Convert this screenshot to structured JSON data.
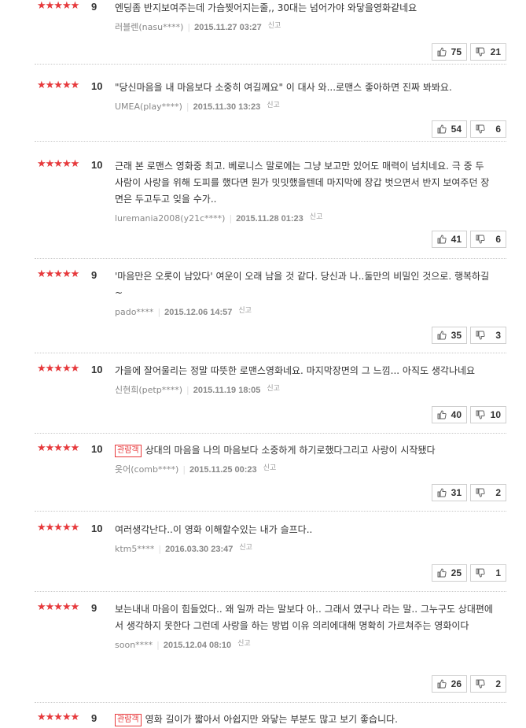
{
  "labels": {
    "report": "신고",
    "badge_watched": "관람객"
  },
  "colors": {
    "star": "#e8393c",
    "badge": "#e8393c"
  },
  "reviews": [
    {
      "score": "9",
      "rating": 9,
      "watched": false,
      "text": "엔딩좀 반지보여주는데 가슴찢어지는줄,, 30대는 넘어가야 와닿을영화같네요",
      "user": "러블렌(nasu****)",
      "date": "2015.11.27 03:27",
      "up": "75",
      "down": "21"
    },
    {
      "score": "10",
      "rating": 10,
      "watched": false,
      "text": "\"당신마음을 내 마음보다 소중히 여길께요\" 이 대사 와...로맨스 좋아하면 진짜 봐봐요.",
      "user": "UMEA(play****)",
      "date": "2015.11.30 13:23",
      "up": "54",
      "down": "6"
    },
    {
      "score": "10",
      "rating": 10,
      "watched": false,
      "text": "근래 본 로맨스 영화중 최고. 베로니스 말로에는 그냥 보고만 있어도 매력이 넘치네요. 극 중 두 사람이 사랑을 위해 도피를 했다면 뭔가 밋밋했을텐데 마지막에 장갑 벗으면서 반지 보여주던 장면은 두고두고 잊을 수가..",
      "user": "luremania2008(y21c****)",
      "date": "2015.11.28 01:23",
      "up": "41",
      "down": "6"
    },
    {
      "score": "9",
      "rating": 9,
      "watched": false,
      "text": "'마음만은 오롯이 남았다' 여운이 오래 남을 것 같다. 당신과 나..둘만의 비밀인 것으로. 행복하길~",
      "user": "pado****",
      "date": "2015.12.06 14:57",
      "up": "35",
      "down": "3"
    },
    {
      "score": "10",
      "rating": 10,
      "watched": false,
      "text": "가을에 잘어울리는 정말 따뜻한 로맨스영화네요. 마지막장면의 그 느낌... 아직도 생각나네요",
      "user": "신현희(petp****)",
      "date": "2015.11.19 18:05",
      "up": "40",
      "down": "10"
    },
    {
      "score": "10",
      "rating": 10,
      "watched": true,
      "text": "상대의 마음을 나의 마음보다 소중하게 하기로했다그리고 사랑이 시작됐다",
      "user": "옷어(comb****)",
      "date": "2015.11.25 00:23",
      "up": "31",
      "down": "2"
    },
    {
      "score": "10",
      "rating": 10,
      "watched": false,
      "text": "여러생각난다..이 영화 이해할수있는 내가 슬프다..",
      "user": "ktm5****",
      "date": "2016.03.30 23:47",
      "up": "25",
      "down": "1"
    },
    {
      "score": "9",
      "rating": 9,
      "watched": false,
      "text": "보는내내 마음이 힘들었다.. 왜 일까 라는 말보다 아.. 그래서 였구나 라는 말.. 그누구도 상대편에서 생각하지 못한다 그런데 사랑을 하는 방법 이유 의리에대해 명확히 가르쳐주는 영화이다",
      "user": "soon****",
      "date": "2015.12.04 08:10",
      "up": "26",
      "down": "2"
    },
    {
      "score": "9",
      "rating": 9,
      "watched": true,
      "text": "영화 길이가 짧아서 아쉽지만 와닿는 부분도 많고 보기 좋습니다.",
      "user": "",
      "date": "",
      "up": "",
      "down": ""
    }
  ]
}
